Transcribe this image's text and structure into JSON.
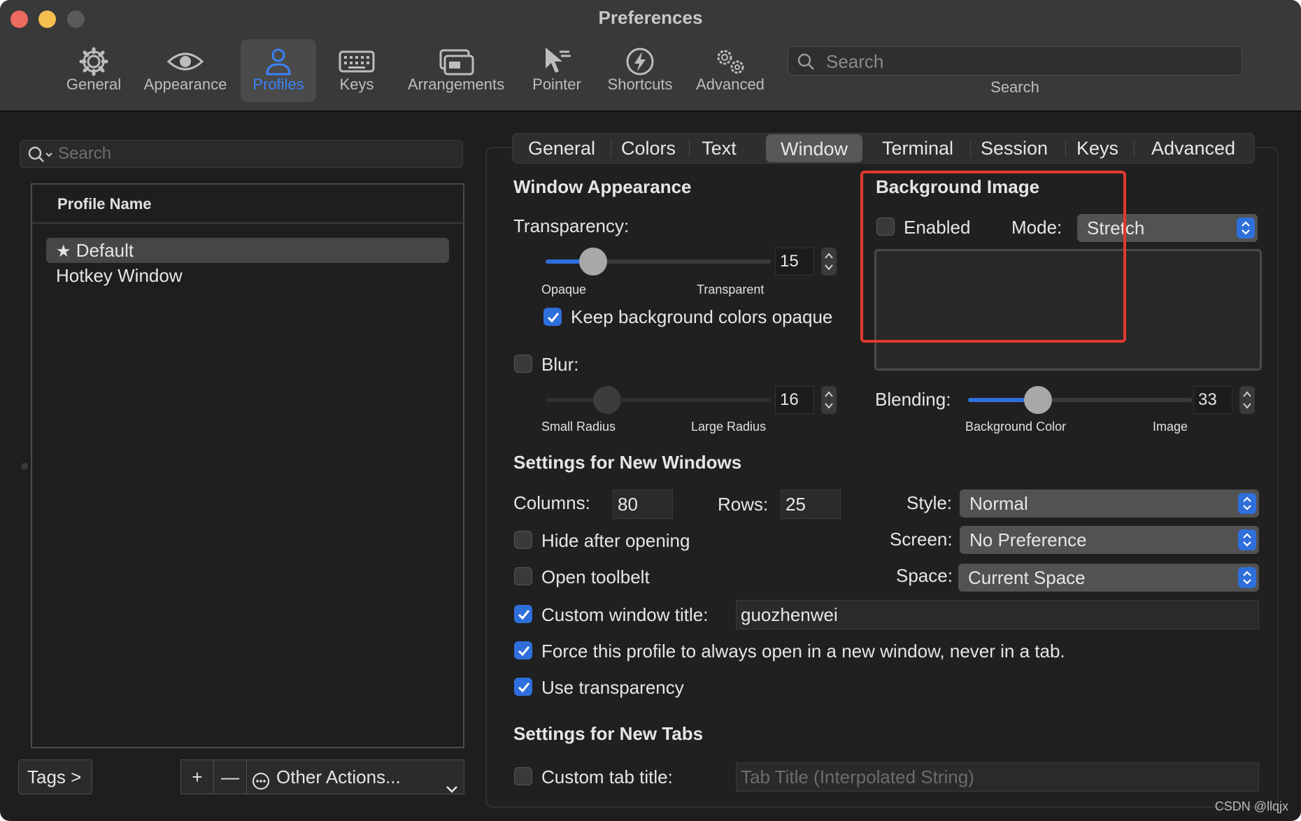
{
  "window": {
    "title": "Preferences",
    "toolbar": [
      {
        "label": "General",
        "icon": "gear-icon"
      },
      {
        "label": "Appearance",
        "icon": "eye-icon"
      },
      {
        "label": "Profiles",
        "icon": "person-icon",
        "active": true
      },
      {
        "label": "Keys",
        "icon": "keyboard-icon"
      },
      {
        "label": "Arrangements",
        "icon": "windows-icon"
      },
      {
        "label": "Pointer",
        "icon": "pointer-icon"
      },
      {
        "label": "Shortcuts",
        "icon": "bolt-icon"
      },
      {
        "label": "Advanced",
        "icon": "gears-icon"
      }
    ],
    "search": {
      "placeholder": "Search",
      "label": "Search"
    }
  },
  "profiles": {
    "search_placeholder": "Search",
    "column_header": "Profile Name",
    "items": [
      {
        "name": "Default",
        "default": true,
        "selected": true
      },
      {
        "name": "Hotkey Window"
      }
    ],
    "tags_label": "Tags >",
    "add_label": "+",
    "remove_label": "—",
    "other_actions_label": "Other Actions..."
  },
  "tabs": [
    "General",
    "Colors",
    "Text",
    "Window",
    "Terminal",
    "Session",
    "Keys",
    "Advanced"
  ],
  "active_tab": "Window",
  "window_appearance": {
    "heading": "Window Appearance",
    "transparency_label": "Transparency:",
    "transparency_value": "15",
    "transparency_min_label": "Opaque",
    "transparency_max_label": "Transparent",
    "keep_bg_opaque_label": "Keep background colors opaque",
    "keep_bg_opaque_checked": true,
    "blur_label": "Blur:",
    "blur_checked": false,
    "blur_value": "16",
    "blur_min_label": "Small Radius",
    "blur_max_label": "Large Radius"
  },
  "background_image": {
    "heading": "Background Image",
    "enabled_label": "Enabled",
    "enabled_checked": false,
    "mode_label": "Mode:",
    "mode_value": "Stretch",
    "blending_label": "Blending:",
    "blending_value": "33",
    "blending_min_label": "Background Color",
    "blending_max_label": "Image"
  },
  "new_windows": {
    "heading": "Settings for New Windows",
    "columns_label": "Columns:",
    "columns_value": "80",
    "rows_label": "Rows:",
    "rows_value": "25",
    "style_label": "Style:",
    "style_value": "Normal",
    "screen_label": "Screen:",
    "screen_value": "No Preference",
    "space_label": "Space:",
    "space_value": "Current Space",
    "hide_after_opening_label": "Hide after opening",
    "hide_after_opening_checked": false,
    "open_toolbelt_label": "Open toolbelt",
    "open_toolbelt_checked": false,
    "custom_title_label": "Custom window title:",
    "custom_title_checked": true,
    "custom_title_value": "guozhenwei",
    "force_new_window_label": "Force this profile to always open in a new window, never in a tab.",
    "force_new_window_checked": true,
    "use_transparency_label": "Use transparency",
    "use_transparency_checked": true
  },
  "new_tabs": {
    "heading": "Settings for New Tabs",
    "custom_tab_title_label": "Custom tab title:",
    "custom_tab_title_checked": false,
    "custom_tab_title_placeholder": "Tab Title (Interpolated String)"
  },
  "watermark": "CSDN @llqjx",
  "colors": {
    "accent": "#2f6fdb",
    "highlight_box": "#e03a2f"
  }
}
